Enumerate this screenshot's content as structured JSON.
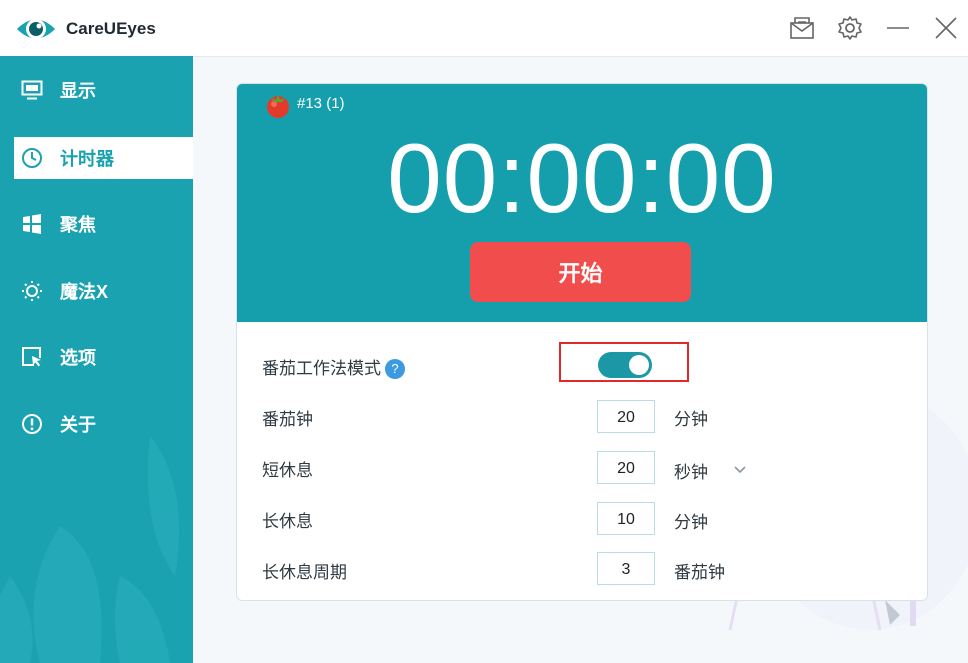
{
  "app": {
    "title": "CareUEyes"
  },
  "titlebar": {
    "icons": [
      "mail-icon",
      "gear-icon",
      "minimize-icon",
      "close-icon"
    ]
  },
  "sidebar": {
    "items": [
      {
        "label": "显示",
        "icon": "monitor-icon",
        "active": false
      },
      {
        "label": "计时器",
        "icon": "clock-icon",
        "active": true
      },
      {
        "label": "聚焦",
        "icon": "windows-icon",
        "active": false
      },
      {
        "label": "魔法X",
        "icon": "sun-icon",
        "active": false
      },
      {
        "label": "选项",
        "icon": "cursor-window-icon",
        "active": false
      },
      {
        "label": "关于",
        "icon": "info-icon",
        "active": false
      }
    ]
  },
  "timer": {
    "round": "#13 (1)",
    "display": "00:00:00",
    "start_label": "开始"
  },
  "settings": {
    "pomodoro_mode_label": "番茄工作法模式",
    "pomodoro_mode_on": true,
    "rows": [
      {
        "label": "番茄钟",
        "value": "20",
        "unit": "分钟"
      },
      {
        "label": "短休息",
        "value": "20",
        "unit": "秒钟"
      },
      {
        "label": "长休息",
        "value": "10",
        "unit": "分钟"
      },
      {
        "label": "长休息周期",
        "value": "3",
        "unit": "番茄钟"
      }
    ]
  },
  "colors": {
    "accent": "#1aa2b0",
    "start_button": "#f24d4d",
    "highlight_border": "#e02a2a"
  }
}
